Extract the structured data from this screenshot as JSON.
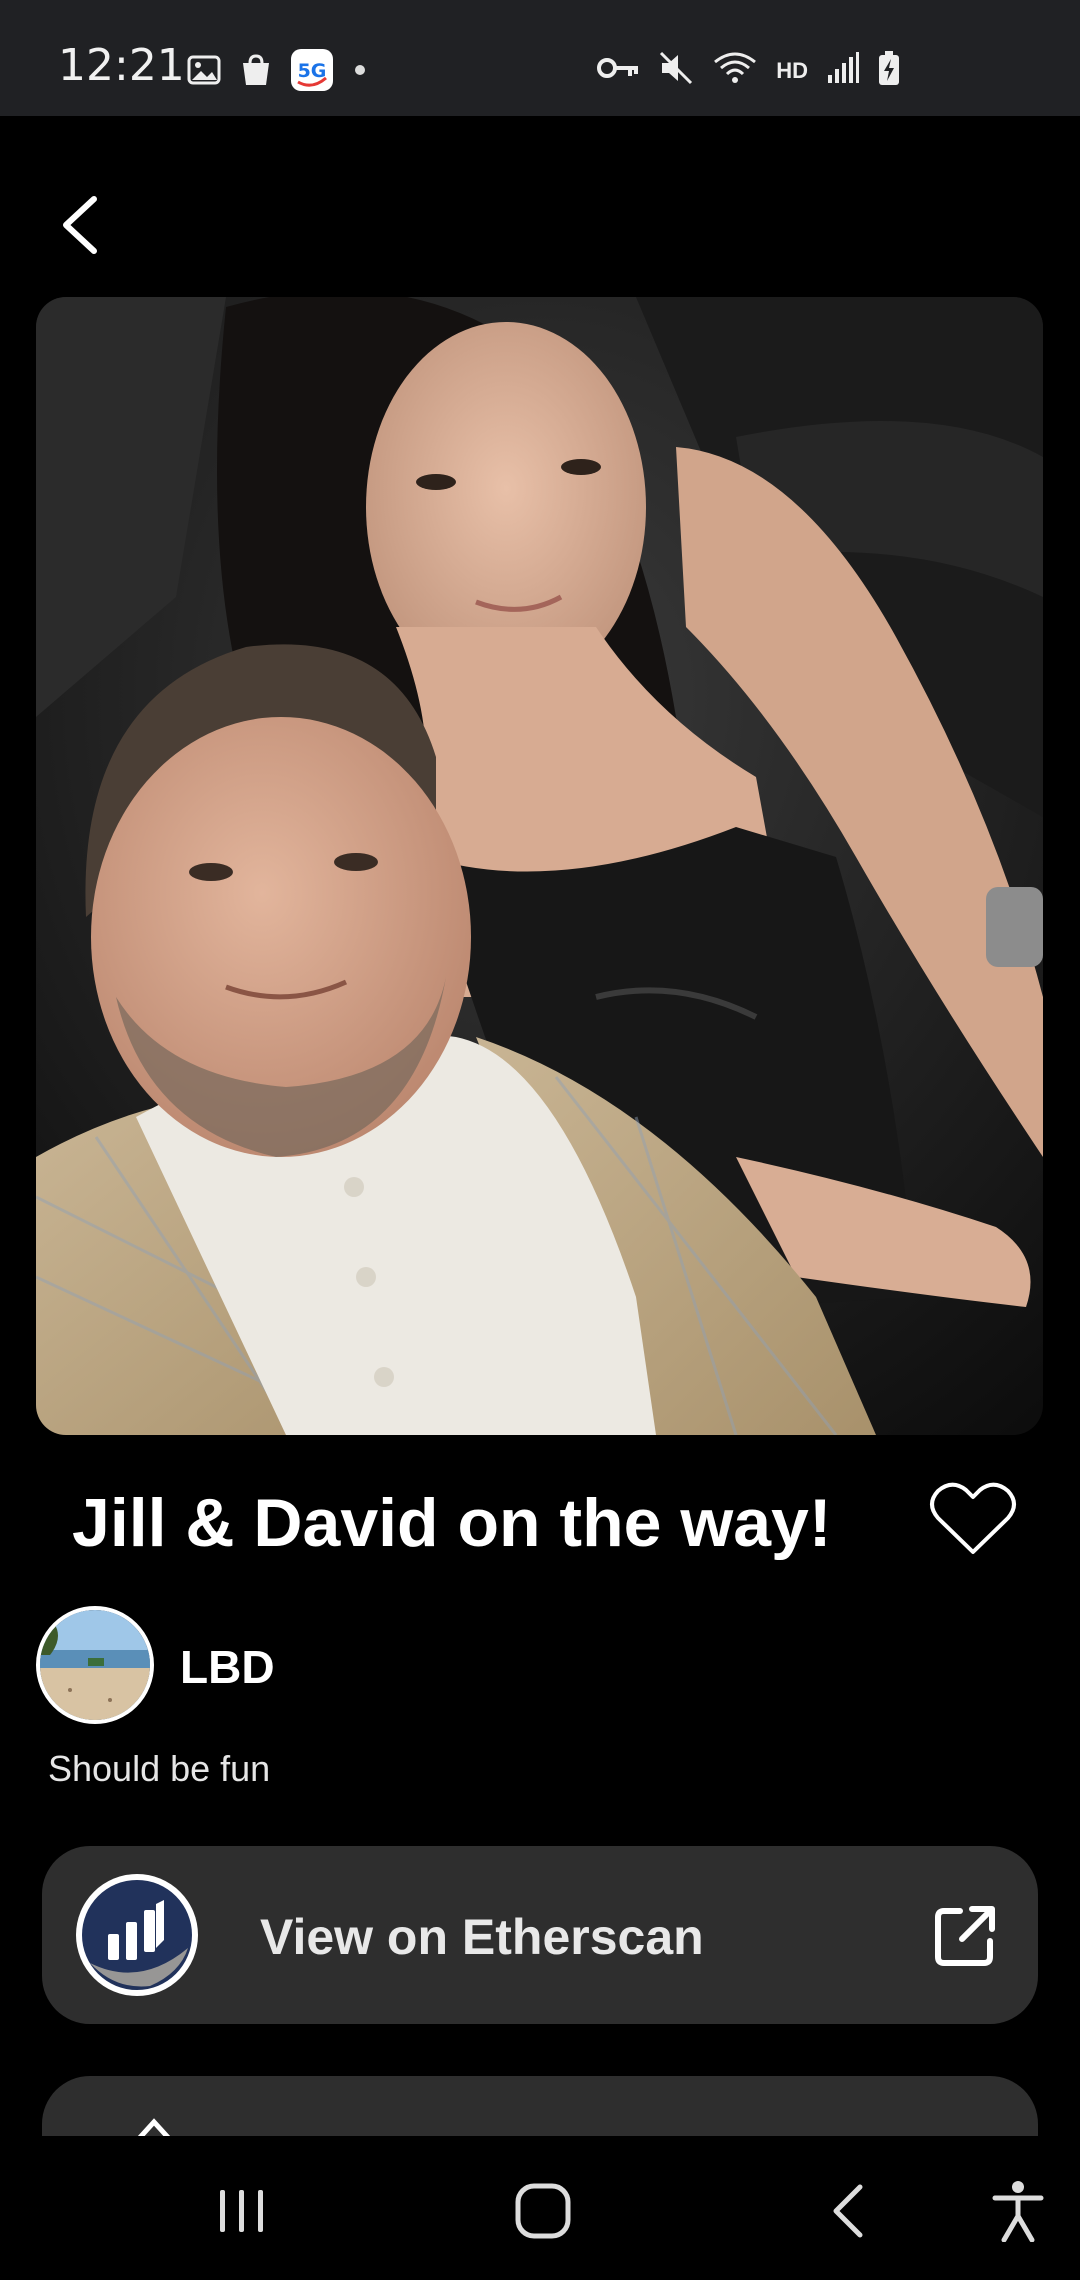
{
  "status_bar": {
    "time": "12:21",
    "network_badge": "5G",
    "hd_label": "HD",
    "left_icons": [
      "gallery-icon",
      "shopping-bag-icon",
      "5g-app-icon",
      "dot-icon"
    ],
    "right_icons": [
      "vpn-key-icon",
      "mute-icon",
      "wifi-icon",
      "hd-icon",
      "signal-icon",
      "battery-charging-icon"
    ]
  },
  "nft": {
    "title": "Jill & David on the way!",
    "owner": "LBD",
    "description": "Should be fun"
  },
  "etherscan": {
    "label": "View on Etherscan"
  },
  "colors": {
    "background": "#000000",
    "status_bar": "#202124",
    "card": "#2e2e2e",
    "etherscan_brand": "#21325b"
  },
  "nav_bar": {
    "icons": [
      "recent-apps-icon",
      "home-icon",
      "back-icon",
      "accessibility-icon"
    ]
  }
}
